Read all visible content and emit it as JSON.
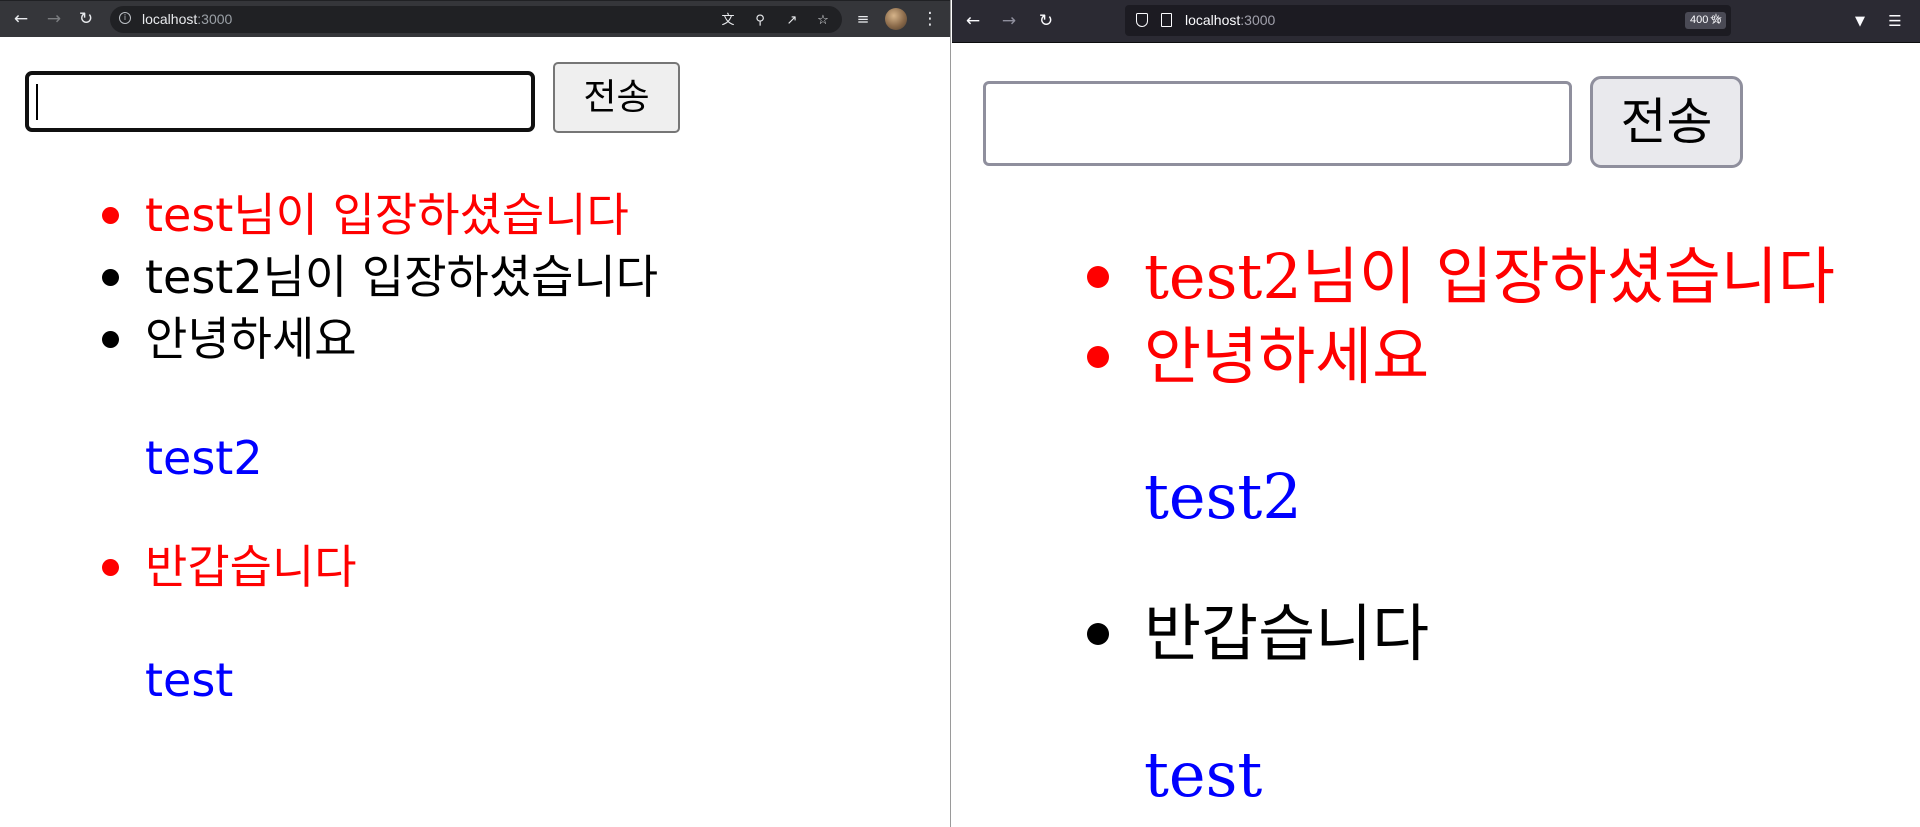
{
  "colors": {
    "system_message": "#ff0000",
    "user_message": "#000000",
    "sender_name": "#0000ff"
  },
  "chrome_window": {
    "toolbar": {
      "back_icon": "arrow-left-icon",
      "forward_icon": "arrow-right-icon",
      "reload_icon": "reload-icon",
      "site_info_icon": "info-icon",
      "url_host": "localhost",
      "url_port": ":3000",
      "translate_icon": "translate-icon",
      "zoom_icon": "zoom-icon",
      "share_icon": "share-icon",
      "bookmark_icon": "star-icon",
      "reading_list_icon": "reading-list-icon",
      "menu_icon": "kebab-menu-icon"
    },
    "chat": {
      "input_value": "",
      "send_label": "전송",
      "messages": [
        {
          "text": "test님이 입장하셨습니다",
          "color": "red",
          "bullet": true
        },
        {
          "text": "test2님이 입장하셨습니다",
          "color": "black",
          "bullet": true
        },
        {
          "text": "안녕하세요",
          "color": "black",
          "bullet": true
        },
        {
          "text": "test2",
          "color": "blue",
          "bullet": false
        },
        {
          "text": "반갑습니다",
          "color": "red",
          "bullet": true
        },
        {
          "text": "test",
          "color": "blue",
          "bullet": false
        }
      ]
    }
  },
  "firefox_window": {
    "toolbar": {
      "back_icon": "arrow-left-icon",
      "forward_icon": "arrow-right-icon",
      "reload_icon": "reload-icon",
      "shield_icon": "tracking-protection-icon",
      "page_icon": "page-icon",
      "url_host": "localhost",
      "url_port": ":3000",
      "zoom_level": "400 %",
      "bookmark_icon": "star-icon",
      "pocket_icon": "pocket-icon",
      "menu_icon": "hamburger-menu-icon"
    },
    "chat": {
      "input_value": "",
      "send_label": "전송",
      "messages": [
        {
          "text": "test2님이 입장하셨습니다",
          "color": "red",
          "bullet": true
        },
        {
          "text": "안녕하세요",
          "color": "red",
          "bullet": true
        },
        {
          "text": "test2",
          "color": "blue",
          "bullet": false
        },
        {
          "text": "반갑습니다",
          "color": "black",
          "bullet": true
        },
        {
          "text": "test",
          "color": "blue",
          "bullet": false
        }
      ]
    }
  }
}
